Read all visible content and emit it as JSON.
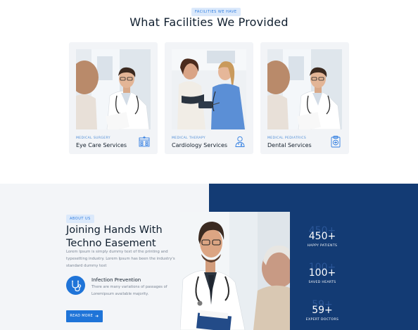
{
  "facilities": {
    "tag": "FACILITIES WE HAVE",
    "heading": "What Facilities We Provided",
    "cards": [
      {
        "category": "MEDICAL SURGERY",
        "title": "Eye Care Services",
        "icon": "clinic-building-icon"
      },
      {
        "category": "MEDICAL THERAPY",
        "title": "Cardiology Services",
        "icon": "doctor-person-icon"
      },
      {
        "category": "MEDICAL PEDIATRICS",
        "title": "Dental Services",
        "icon": "medical-clipboard-icon"
      }
    ]
  },
  "about": {
    "tag": "ABOUT US",
    "heading": "Joining Hands With Techno Easement",
    "paragraph": "Lorem Ipsum is simply dummy text of the printing and typesetting industry. Lorem Ipsum has been the industry's standard dummy text",
    "feature": {
      "icon": "stethoscope-icon",
      "title": "Infection Prevention",
      "text": "There are many variations of passages of Loremipsum available majority."
    },
    "button": "READ MORE"
  },
  "stats": [
    {
      "value": "450+",
      "label": "HAPPY PATIENTS"
    },
    {
      "value": "100+",
      "label": "SAVED HEARTS"
    },
    {
      "value": "59+",
      "label": "EXPERT DOCTORS"
    }
  ],
  "colors": {
    "accent": "#1f74d8",
    "navy": "#133b74",
    "tag_bg": "#dbe9fb",
    "card_bg": "#f2f4f7"
  }
}
